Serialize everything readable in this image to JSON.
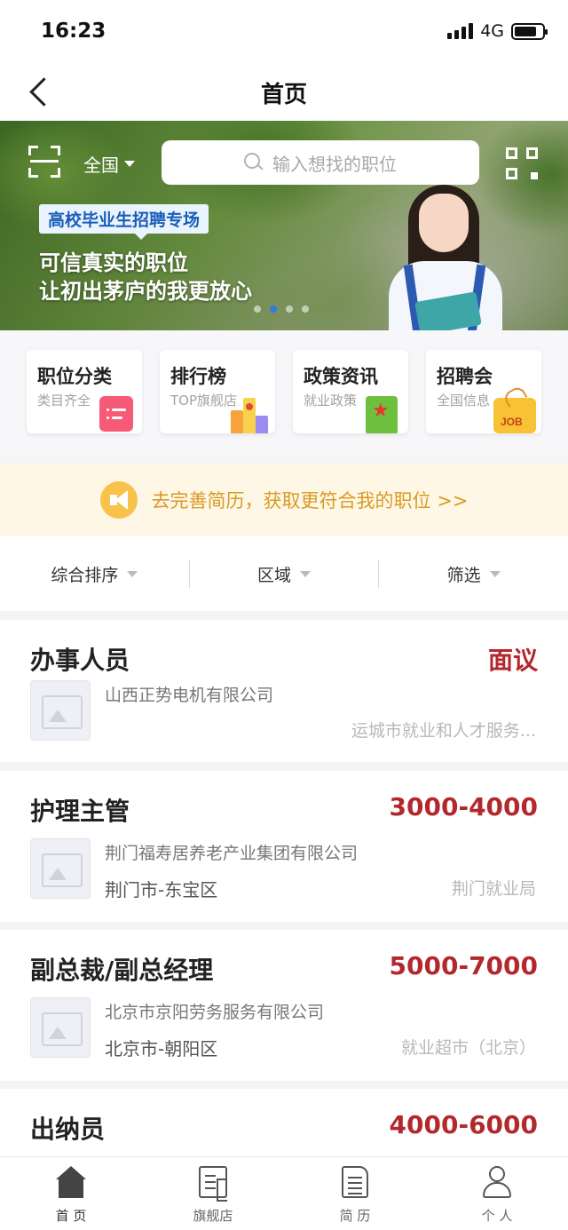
{
  "status_bar": {
    "time": "16:23",
    "network": "4G"
  },
  "nav": {
    "title": "首页"
  },
  "banner": {
    "region": "全国",
    "search_placeholder": "输入想找的职位",
    "tag": "高校毕业生招聘专场",
    "line1": "可信真实的职位",
    "line2": "让初出茅庐的我更放心",
    "dots_total": 4,
    "active_dot": 2
  },
  "quick_entries": [
    {
      "title": "职位分类",
      "sub": "类目齐全",
      "icon": "list-icon"
    },
    {
      "title": "排行榜",
      "sub": "TOP旗舰店",
      "icon": "ranking-icon"
    },
    {
      "title": "政策资讯",
      "sub": "就业政策",
      "icon": "policy-book-icon"
    },
    {
      "title": "招聘会",
      "sub": "全国信息",
      "icon": "job-fair-icon",
      "icon_text": "JOB"
    }
  ],
  "notice": {
    "text": "去完善简历，获取更符合我的职位 >>"
  },
  "filters": [
    {
      "label": "综合排序"
    },
    {
      "label": "区域"
    },
    {
      "label": "筛选"
    }
  ],
  "jobs": [
    {
      "title": "办事人员",
      "salary": "面议",
      "company": "山西正势电机有限公司",
      "location": "",
      "source": "运城市就业和人才服务..."
    },
    {
      "title": "护理主管",
      "salary": "3000-4000",
      "company": "荆门福寿居养老产业集团有限公司",
      "location": "荆门市-东宝区",
      "source": "荆门就业局"
    },
    {
      "title": "副总裁/副总经理",
      "salary": "5000-7000",
      "company": "北京市京阳劳务服务有限公司",
      "location": "北京市-朝阳区",
      "source": "就业超市（北京）"
    },
    {
      "title": "出纳员",
      "salary": "4000-6000",
      "company": "",
      "location": "",
      "source": ""
    }
  ],
  "tab_bar": [
    {
      "label": "首 页",
      "icon": "home-icon",
      "active": true
    },
    {
      "label": "旗舰店",
      "icon": "store-icon",
      "active": false
    },
    {
      "label": "简 历",
      "icon": "resume-icon",
      "active": false
    },
    {
      "label": "个 人",
      "icon": "user-icon",
      "active": false
    }
  ],
  "colors": {
    "salary": "#b3282d",
    "notice_text": "#d99a22",
    "notice_bg": "#fff7e6",
    "active_dot": "#2f7be0"
  }
}
